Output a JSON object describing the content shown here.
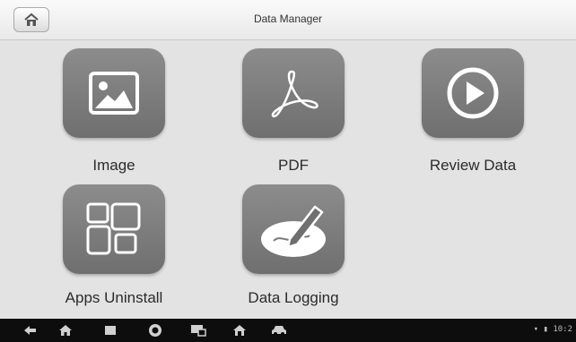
{
  "header": {
    "title": "Data Manager",
    "home_icon": "home-icon"
  },
  "tiles": [
    {
      "label": "Image",
      "icon": "image-icon"
    },
    {
      "label": "PDF",
      "icon": "pdf-icon"
    },
    {
      "label": "Review Data",
      "icon": "play-icon"
    },
    {
      "label": "Apps Uninstall",
      "icon": "apps-grid-icon"
    },
    {
      "label": "Data Logging",
      "icon": "data-logging-icon"
    }
  ],
  "colors": {
    "tile": "#7d7d7d",
    "background": "#e3e3e3",
    "navbar": "#0d0d0d"
  },
  "navbar": {
    "icons": [
      "back-icon",
      "android-home-icon",
      "recent-apps-icon",
      "browser-icon",
      "screenshot-icon",
      "vci-home-icon",
      "car-icon"
    ],
    "status_text": "10:2"
  }
}
